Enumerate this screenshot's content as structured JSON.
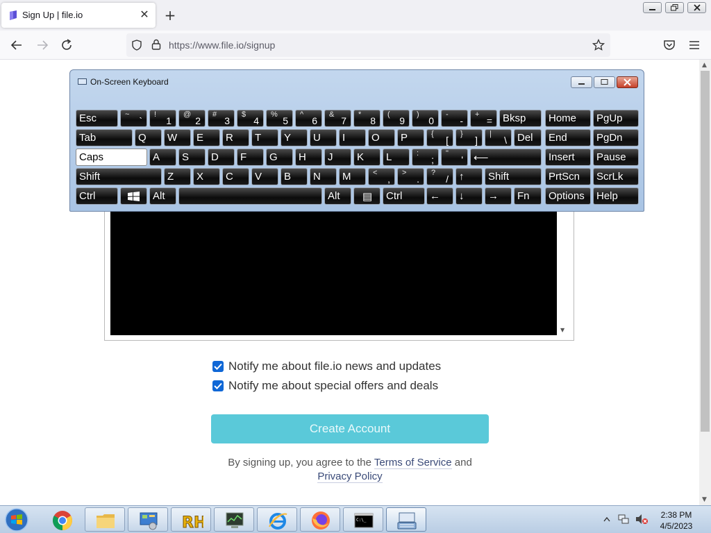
{
  "browser": {
    "tab_title": "Sign Up | file.io",
    "tab_close": "✕",
    "new_tab": "+",
    "url": "https://www.file.io/signup"
  },
  "keyboard": {
    "title": "On-Screen Keyboard",
    "keys": {
      "esc": "Esc",
      "tilde_top": "~",
      "tilde_bot": "`",
      "k1_top": "!",
      "k1_bot": "1",
      "k2_top": "@",
      "k2_bot": "2",
      "k3_top": "#",
      "k3_bot": "3",
      "k4_top": "$",
      "k4_bot": "4",
      "k5_top": "%",
      "k5_bot": "5",
      "k6_top": "^",
      "k6_bot": "6",
      "k7_top": "&",
      "k7_bot": "7",
      "k8_top": "*",
      "k8_bot": "8",
      "k9_top": "(",
      "k9_bot": "9",
      "k0_top": ")",
      "k0_bot": "0",
      "minus_top": "-",
      "minus_bot": "-",
      "plus_top": "+",
      "plus_bot": "=",
      "bksp": "Bksp",
      "home": "Home",
      "pgup": "PgUp",
      "tab": "Tab",
      "q": "Q",
      "w": "W",
      "e": "E",
      "r": "R",
      "t": "T",
      "y": "Y",
      "u": "U",
      "i": "I",
      "o": "O",
      "p": "P",
      "lbrace_top": "{",
      "lbrace_bot": "[",
      "rbrace_top": "}",
      "rbrace_bot": "]",
      "pipe_top": "|",
      "pipe_bot": "\\",
      "del": "Del",
      "end": "End",
      "pgdn": "PgDn",
      "caps": "Caps",
      "a": "A",
      "s": "S",
      "d": "D",
      "f": "F",
      "g": "G",
      "h": "H",
      "j": "J",
      "k": "K",
      "l": "L",
      "colon_top": ":",
      "colon_bot": ";",
      "quote_top": "\"",
      "quote_bot": "'",
      "enter": "⟵",
      "insert": "Insert",
      "pause": "Pause",
      "lshift": "Shift",
      "z": "Z",
      "x": "X",
      "c": "C",
      "v": "V",
      "b": "B",
      "n": "N",
      "m": "M",
      "comma_top": "<",
      "comma_bot": ",",
      "period_top": ">",
      "period_bot": ".",
      "slash_top": "?",
      "slash_bot": "/",
      "up": "↑",
      "rshift": "Shift",
      "prtscn": "PrtScn",
      "scrlk": "ScrLk",
      "lctrl": "Ctrl",
      "lalt": "Alt",
      "ralt": "Alt",
      "menu": "▤",
      "rctrl": "Ctrl",
      "left": "←",
      "down": "↓",
      "right": "→",
      "fn": "Fn",
      "options": "Options",
      "help": "Help"
    }
  },
  "form": {
    "notify_news": "Notify me about file.io news and updates",
    "notify_offers": "Notify me about special offers and deals",
    "create_account": "Create Account",
    "legal_prefix": "By signing up, you agree to the",
    "terms": "Terms of Service",
    "legal_and": "and",
    "privacy": "Privacy Policy"
  },
  "taskbar": {
    "time": "2:38 PM",
    "date": "4/5/2023"
  },
  "colors": {
    "create_button": "#5ac9d9",
    "checkbox": "#0f67d6",
    "link": "#3a4a78"
  }
}
